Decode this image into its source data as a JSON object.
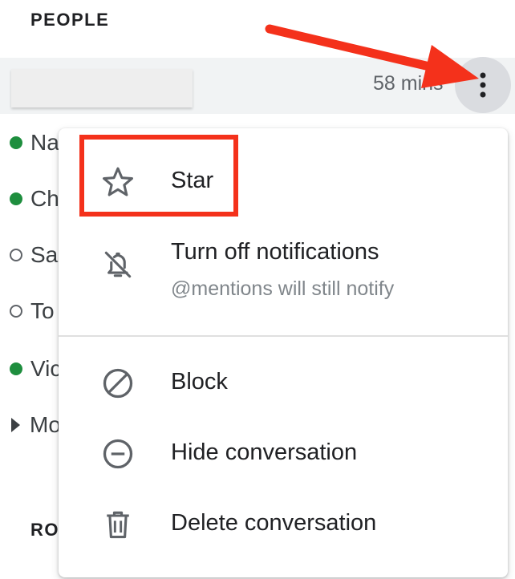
{
  "people_heading": "PEOPLE",
  "rooms_heading": "RO",
  "selected_conversation": {
    "time": "58 mins"
  },
  "people": [
    {
      "name": "Na",
      "status": "online"
    },
    {
      "name": "Ch",
      "status": "online"
    },
    {
      "name": "Sa",
      "status": "offline"
    },
    {
      "name": "To",
      "status": "offline"
    },
    {
      "name": "Vic",
      "status": "online"
    }
  ],
  "more_link": "Mo",
  "menu": {
    "items": [
      {
        "label": "Star",
        "icon": "star-icon"
      },
      {
        "label": "Turn off notifications",
        "sublabel": "@mentions will still notify",
        "icon": "bell-off-icon"
      },
      {
        "label": "Block",
        "icon": "block-icon"
      },
      {
        "label": "Hide conversation",
        "icon": "minus-circle-icon"
      },
      {
        "label": "Delete conversation",
        "icon": "trash-icon"
      }
    ]
  },
  "colors": {
    "annotation": "#f4311b",
    "online": "#1e8e3e",
    "menu_text": "#202124",
    "secondary_text": "#80868b"
  }
}
